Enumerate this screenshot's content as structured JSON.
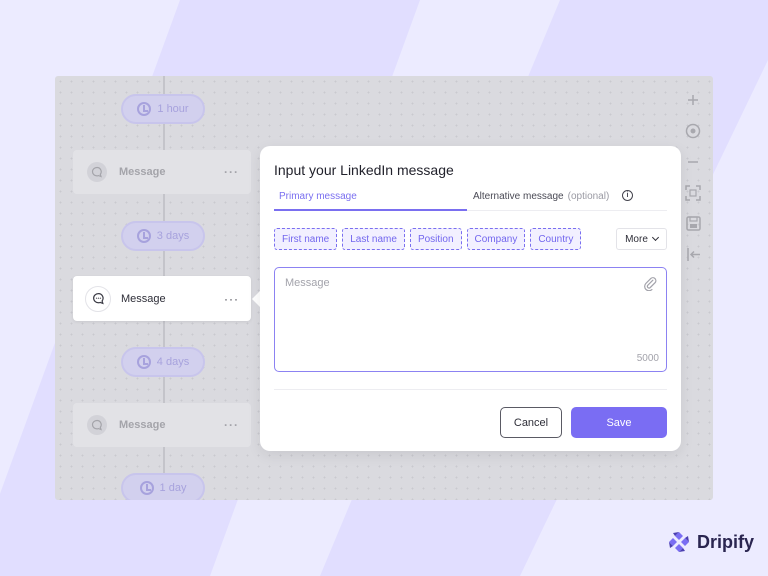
{
  "canvas": {
    "delays": [
      {
        "label": "1 hour"
      },
      {
        "label": "3 days"
      },
      {
        "label": "4 days"
      },
      {
        "label": "1 day"
      }
    ],
    "nodes": [
      {
        "label": "Message",
        "menu": "···"
      },
      {
        "label": "Message",
        "menu": "···"
      }
    ],
    "active_node": {
      "label": "Message",
      "menu": "···"
    }
  },
  "toolbar": {
    "icons": [
      "plus-icon",
      "target-icon",
      "minus-icon",
      "fit-screen-icon",
      "save-icon",
      "exit-icon"
    ],
    "plus": "+",
    "minus": "−"
  },
  "modal": {
    "title": "Input your LinkedIn message",
    "tabs": {
      "primary": "Primary message",
      "alternative": "Alternative message",
      "optional": "(optional)",
      "info": "i"
    },
    "chips": [
      {
        "label": "First name"
      },
      {
        "label": "Last name"
      },
      {
        "label": "Position"
      },
      {
        "label": "Company"
      },
      {
        "label": "Country"
      }
    ],
    "more_label": "More",
    "message": {
      "value": "",
      "placeholder": "Message",
      "counter": "5000"
    },
    "cancel_label": "Cancel",
    "save_label": "Save"
  },
  "brand": {
    "name": "Dripify"
  },
  "colors": {
    "accent": "#7A6DF3",
    "page_bg": "#ECEBFF",
    "stripe": "#E1DEFF"
  }
}
